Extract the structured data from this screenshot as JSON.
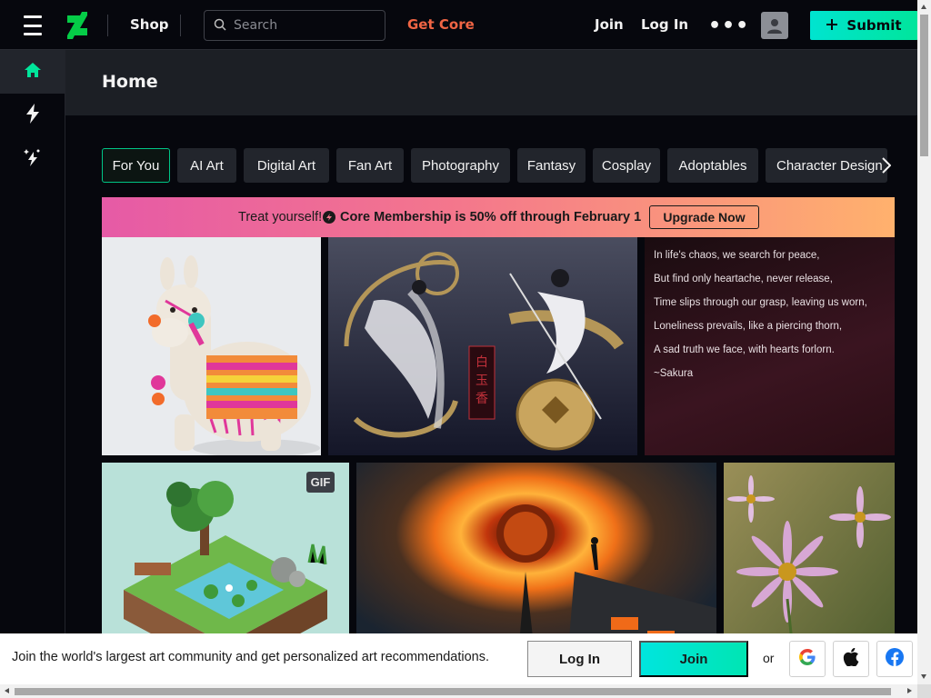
{
  "header": {
    "shop_label": "Shop",
    "search_placeholder": "Search",
    "get_core_label": "Get Core",
    "join_label": "Join",
    "login_label": "Log In",
    "more_label": "•••",
    "submit_label": "Submit"
  },
  "page": {
    "title": "Home"
  },
  "tabs": [
    {
      "label": "For You",
      "active": true
    },
    {
      "label": "AI Art"
    },
    {
      "label": "Digital Art"
    },
    {
      "label": "Fan Art"
    },
    {
      "label": "Photography"
    },
    {
      "label": "Fantasy"
    },
    {
      "label": "Cosplay"
    },
    {
      "label": "Adoptables"
    },
    {
      "label": "Character Design"
    }
  ],
  "promo": {
    "text": "Treat yourself!",
    "offer": "Core Membership is 50% off through February 1",
    "button_label": "Upgrade Now"
  },
  "poem": {
    "lines": [
      "In life's chaos, we search for peace,",
      "But find only heartache, never release,",
      "Time slips through our grasp, leaving us worn,",
      "Loneliness prevails, like a piercing thorn,",
      "A sad truth we face, with hearts forlorn.",
      "~Sakura"
    ]
  },
  "badges": {
    "gif": "GIF"
  },
  "joinbar": {
    "text": "Join the world's largest art community and get personalized art recommendations.",
    "login_label": "Log In",
    "join_label": "Join",
    "or_label": "or"
  },
  "colors": {
    "accent": "#00e59b",
    "get_core": "#f16544",
    "background": "#06070d",
    "panel": "#1c1f25"
  }
}
